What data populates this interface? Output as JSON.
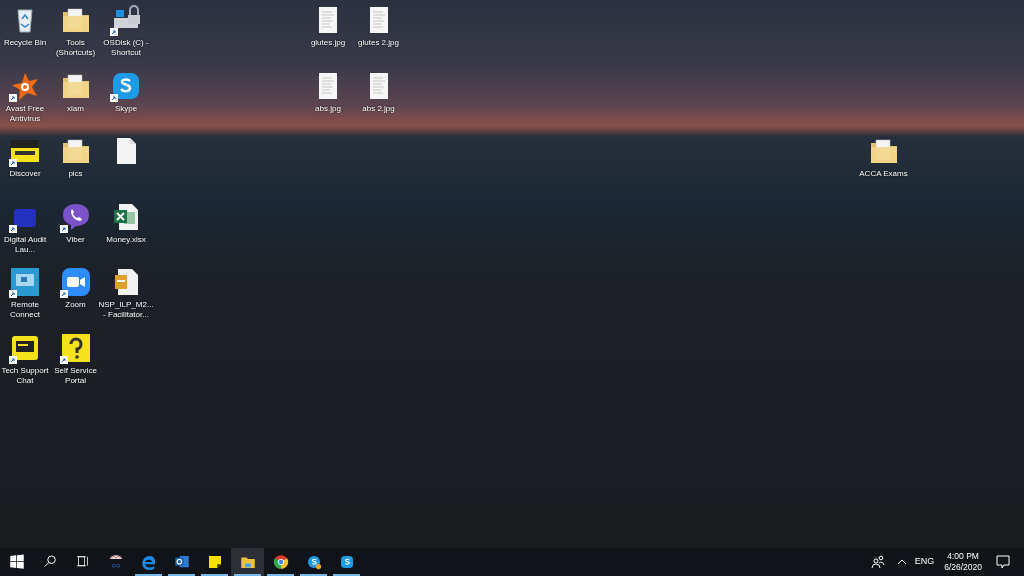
{
  "desktop": {
    "left_group": [
      [
        {
          "kind": "recycle-bin",
          "label": "Recycle Bin",
          "shortcut": false
        },
        {
          "kind": "avast",
          "label": "Avast Free Antivirus",
          "shortcut": true
        },
        {
          "kind": "discover",
          "label": "Discover",
          "shortcut": true
        },
        {
          "kind": "blob-app",
          "label": "Digital Audit Lau...",
          "shortcut": true
        },
        {
          "kind": "remote",
          "label": "Remote Connect",
          "shortcut": true
        },
        {
          "kind": "chat",
          "label": "Tech Support Chat",
          "shortcut": true
        }
      ],
      [
        {
          "kind": "folder",
          "label": "Tools (Shortcuts)",
          "shortcut": false
        },
        {
          "kind": "folder",
          "label": "xlam",
          "shortcut": false
        },
        {
          "kind": "folder",
          "label": "pics",
          "shortcut": false
        },
        {
          "kind": "viber",
          "label": "Viber",
          "shortcut": true
        },
        {
          "kind": "zoom",
          "label": "Zoom",
          "shortcut": true
        },
        {
          "kind": "question",
          "label": "Self Service Portal",
          "shortcut": true
        }
      ],
      [
        {
          "kind": "drive",
          "label": "OSDisk (C) - Shortcut",
          "shortcut": true
        },
        {
          "kind": "skype",
          "label": "Skype",
          "shortcut": true
        },
        {
          "kind": "blank-file",
          "shortcut": false
        },
        {
          "kind": "excel",
          "label": "Money.xlsx",
          "shortcut": false
        },
        {
          "kind": "archive",
          "label": "NSP_ILP_M2... - Facilitator...",
          "shortcut": false
        }
      ]
    ],
    "center_group": [
      [
        {
          "kind": "image-file",
          "label": "glutes.jpg",
          "shortcut": false
        },
        {
          "kind": "image-file",
          "label": "abs.jpg",
          "shortcut": false
        }
      ],
      [
        {
          "kind": "image-file",
          "label": "glutes 2.jpg",
          "shortcut": false
        },
        {
          "kind": "image-file",
          "label": "abs 2.jpg",
          "shortcut": false
        }
      ]
    ],
    "right_group": [
      [
        {
          "kind": "folder",
          "label": "ACCA Exams",
          "shortcut": false
        }
      ]
    ]
  },
  "taskbar": {
    "items": [
      {
        "kind": "start",
        "running": false,
        "selected": false
      },
      {
        "kind": "search",
        "running": false,
        "selected": false
      },
      {
        "kind": "task-view",
        "running": false,
        "selected": false
      },
      {
        "kind": "snip",
        "running": false,
        "selected": false
      },
      {
        "kind": "edge",
        "running": true,
        "selected": false
      },
      {
        "kind": "outlook",
        "running": true,
        "selected": false
      },
      {
        "kind": "sticky",
        "running": true,
        "selected": false
      },
      {
        "kind": "explorer",
        "running": true,
        "selected": true
      },
      {
        "kind": "chrome",
        "running": true,
        "selected": false
      },
      {
        "kind": "skype-badge",
        "running": true,
        "selected": false
      },
      {
        "kind": "skype",
        "running": true,
        "selected": false
      }
    ],
    "tray": {
      "language": "ENG",
      "time": "4:00 PM",
      "date": "6/26/2020"
    }
  }
}
